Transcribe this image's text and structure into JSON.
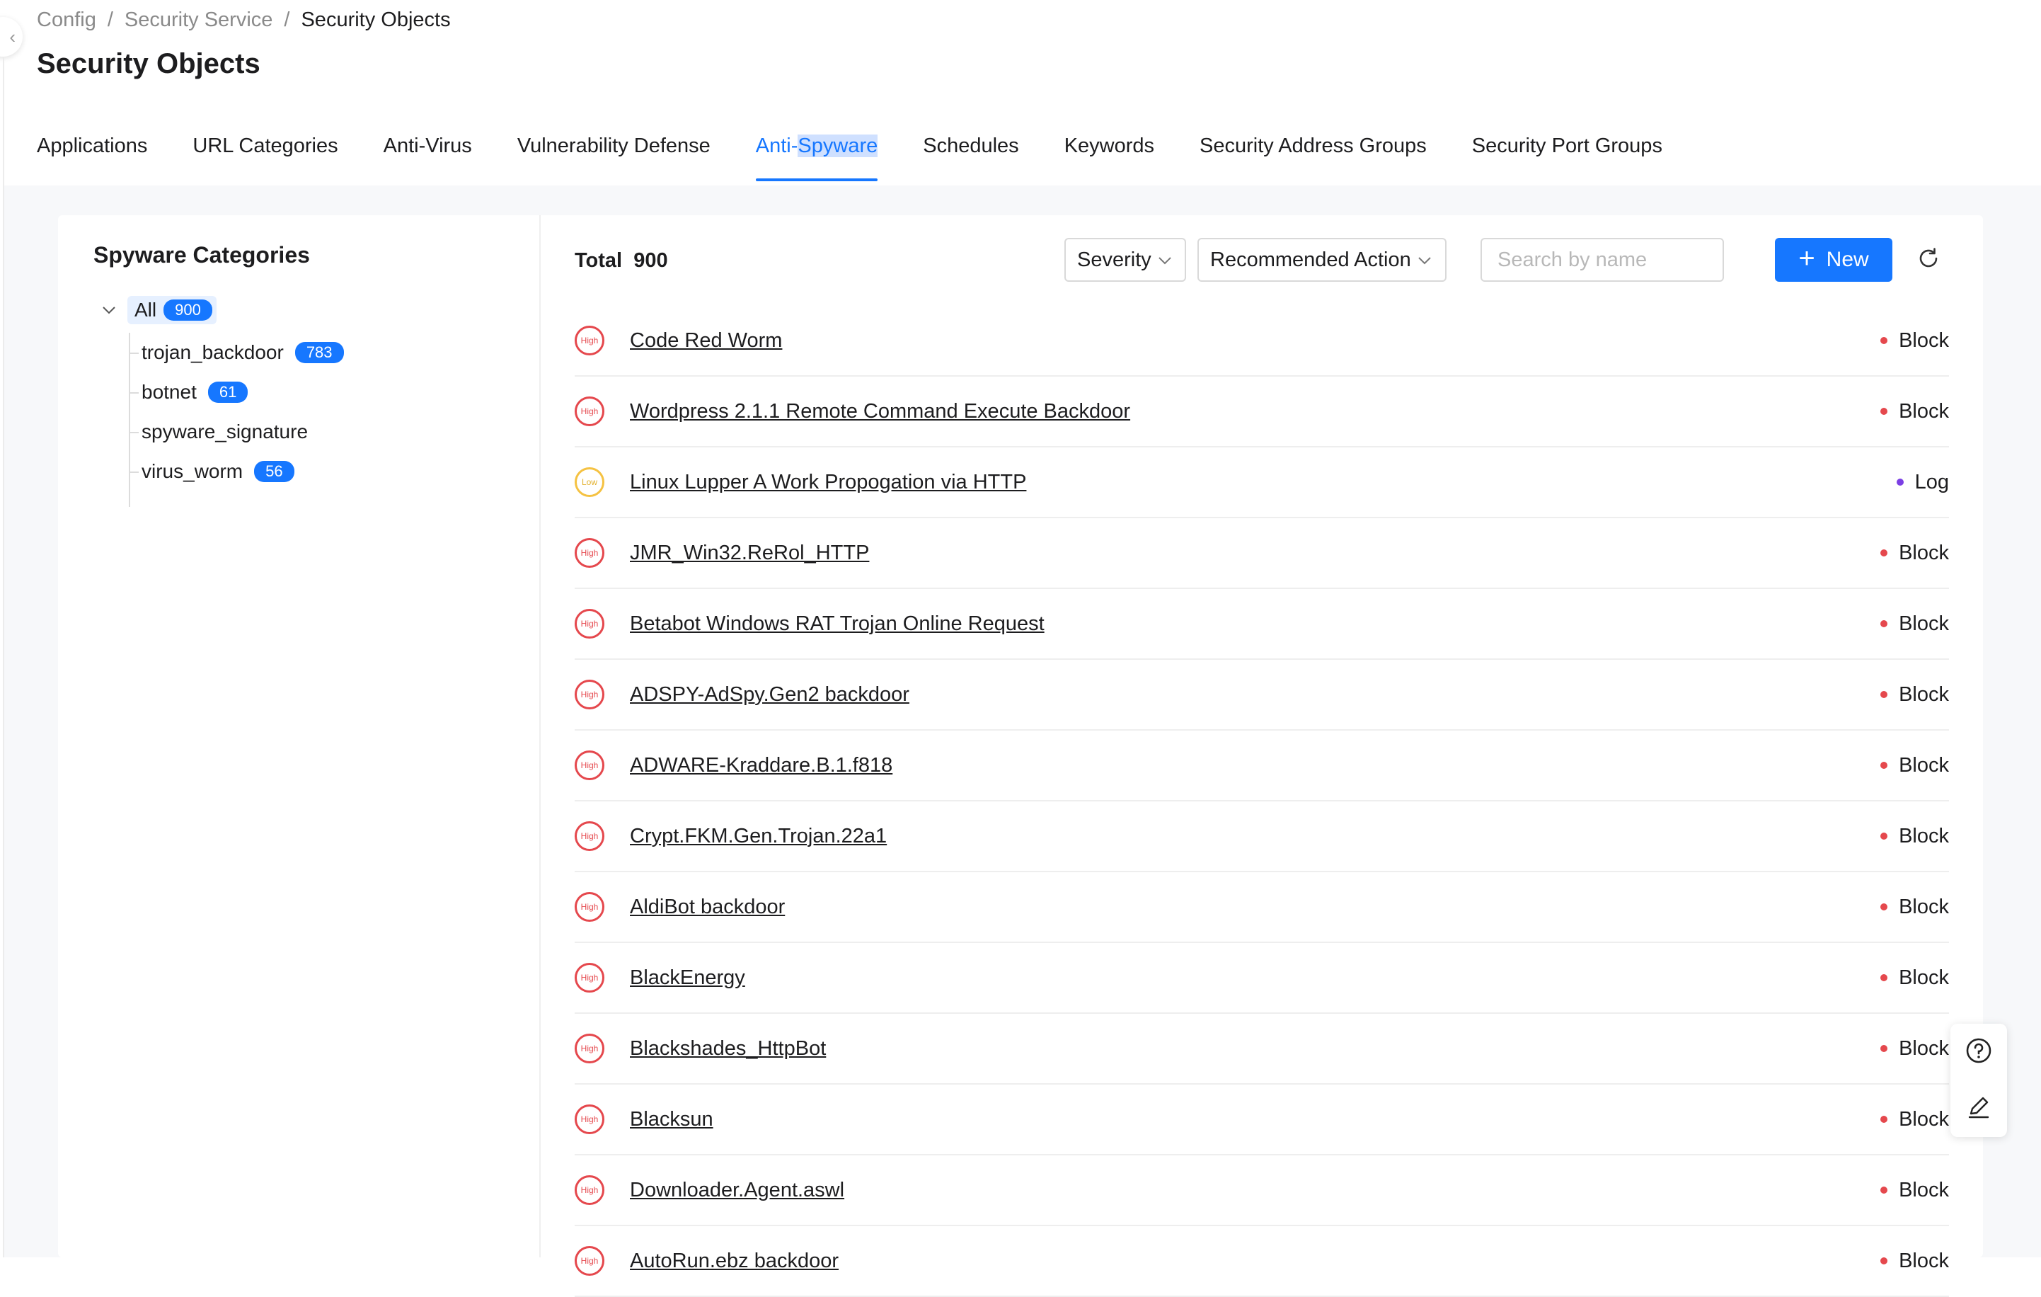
{
  "breadcrumb": [
    "Config",
    "Security Service",
    "Security Objects"
  ],
  "breadcrumb_separator": "/",
  "page_title": "Security Objects",
  "tabs": [
    "Applications",
    "URL Categories",
    "Anti-Virus",
    "Vulnerability Defense",
    "Anti-",
    "Spyware",
    "Schedules",
    "Keywords",
    "Security Address Groups",
    "Security Port Groups"
  ],
  "active_tab": "Anti-Spyware",
  "categories": {
    "title": "Spyware Categories",
    "root": {
      "label": "All",
      "count": "900"
    },
    "children": [
      {
        "label": "trojan_backdoor",
        "count": "783"
      },
      {
        "label": "botnet",
        "count": "61"
      },
      {
        "label": "spyware_signature",
        "count": ""
      },
      {
        "label": "virus_worm",
        "count": "56"
      }
    ]
  },
  "toolbar": {
    "total_label": "Total",
    "total_value": "900",
    "severity_label": "Severity",
    "action_label": "Recommended Action",
    "search_placeholder": "Search by name",
    "new_label": "New"
  },
  "rows": [
    {
      "severity": "High",
      "name": "Code Red Worm",
      "action": "Block"
    },
    {
      "severity": "High",
      "name": "Wordpress 2.1.1 Remote Command Execute Backdoor",
      "action": "Block"
    },
    {
      "severity": "Low",
      "name": "Linux Lupper A Work Propogation via HTTP",
      "action": "Log"
    },
    {
      "severity": "High",
      "name": "JMR_Win32.ReRol_HTTP",
      "action": "Block"
    },
    {
      "severity": "High",
      "name": "Betabot Windows RAT Trojan Online Request",
      "action": "Block"
    },
    {
      "severity": "High",
      "name": "ADSPY-AdSpy.Gen2 backdoor",
      "action": "Block"
    },
    {
      "severity": "High",
      "name": "ADWARE-Kraddare.B.1.f818",
      "action": "Block"
    },
    {
      "severity": "High",
      "name": "Crypt.FKM.Gen.Trojan.22a1",
      "action": "Block"
    },
    {
      "severity": "High",
      "name": "AldiBot backdoor",
      "action": "Block"
    },
    {
      "severity": "High",
      "name": "BlackEnergy",
      "action": "Block"
    },
    {
      "severity": "High",
      "name": "Blackshades_HttpBot",
      "action": "Block"
    },
    {
      "severity": "High",
      "name": "Blacksun",
      "action": "Block"
    },
    {
      "severity": "High",
      "name": "Downloader.Agent.aswl",
      "action": "Block"
    },
    {
      "severity": "High",
      "name": "AutoRun.ebz backdoor",
      "action": "Block"
    }
  ],
  "colors": {
    "accent": "#1677ff",
    "high": "#e5484d",
    "low": "#f5c242",
    "log": "#7b3fe4"
  }
}
